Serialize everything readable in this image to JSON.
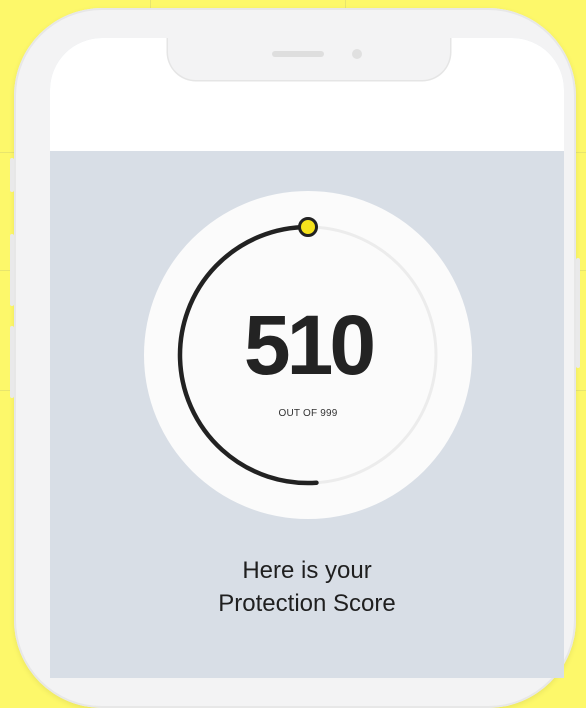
{
  "score_card": {
    "score": "510",
    "out_of_label": "OUT OF 999",
    "score_value": 510,
    "score_max": 999
  },
  "caption": {
    "line1": "Here is your",
    "line2": "Protection Score"
  },
  "colors": {
    "background": "#fdf86a",
    "screen_bg": "#d8dee6",
    "arc": "#222222",
    "knob": "#f5e21c"
  }
}
